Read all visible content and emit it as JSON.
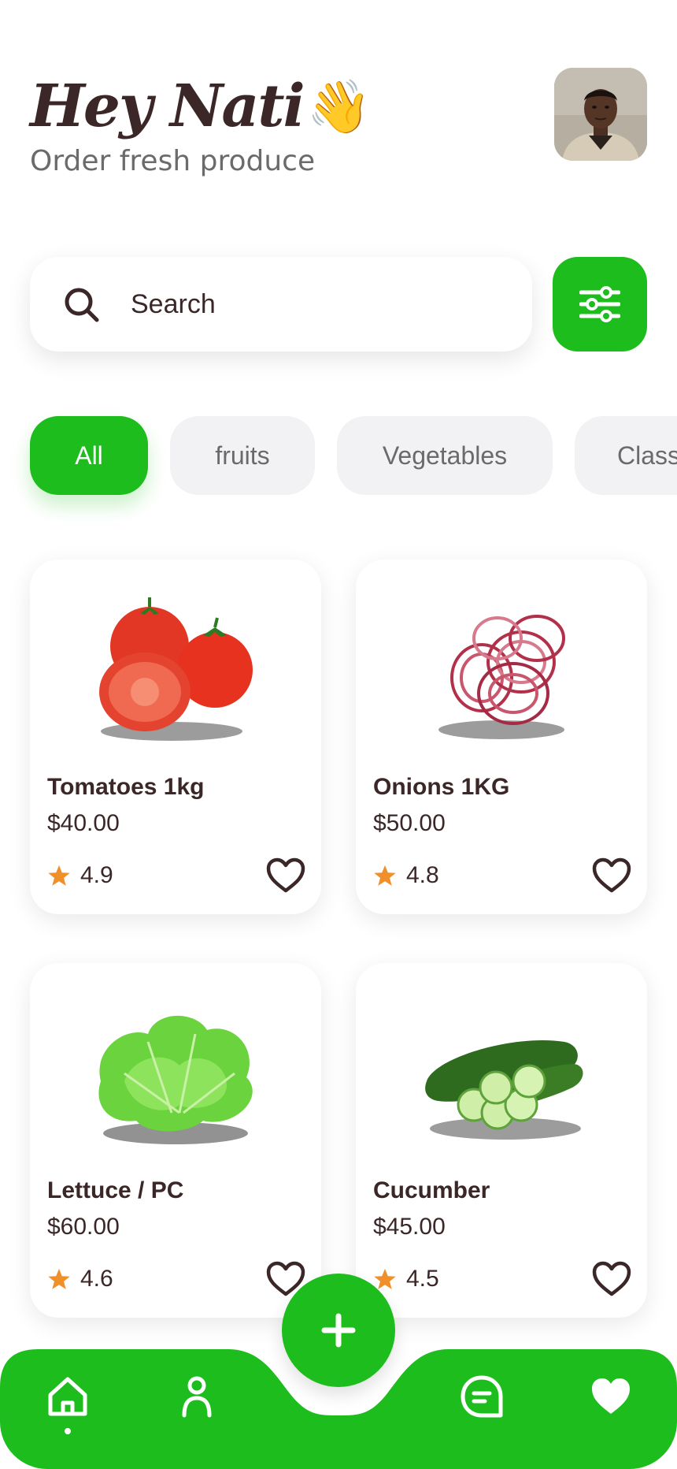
{
  "header": {
    "greeting": "Hey Nati",
    "wave_emoji": "👋",
    "subtitle": "Order fresh produce",
    "avatar_icon": "user-avatar-photo"
  },
  "search": {
    "placeholder": "Search",
    "filter_icon": "sliders-icon"
  },
  "categories": [
    {
      "label": "All",
      "active": true
    },
    {
      "label": "fruits",
      "active": false
    },
    {
      "label": "Vegetables",
      "active": false
    },
    {
      "label": "Class",
      "active": false
    }
  ],
  "products": [
    {
      "name": "Tomatoes 1kg",
      "price": "$40.00",
      "rating": "4.9",
      "image": "tomatoes"
    },
    {
      "name": "Onions 1KG",
      "price": "$50.00",
      "rating": "4.8",
      "image": "onions"
    },
    {
      "name": "Lettuce / PC",
      "price": "$60.00",
      "rating": "4.6",
      "image": "lettuce"
    },
    {
      "name": "Cucumber",
      "price": "$45.00",
      "rating": "4.5",
      "image": "cucumber"
    }
  ],
  "nav": {
    "items": [
      "home-icon",
      "profile-icon",
      "chat-icon",
      "favorites-icon"
    ],
    "fab_icon": "plus-icon",
    "active": "home-icon"
  },
  "colors": {
    "brand_green": "#1cbd1c",
    "text_dark": "#3b2727",
    "star_orange": "#f0902b",
    "chip_bg": "#f2f2f4"
  }
}
